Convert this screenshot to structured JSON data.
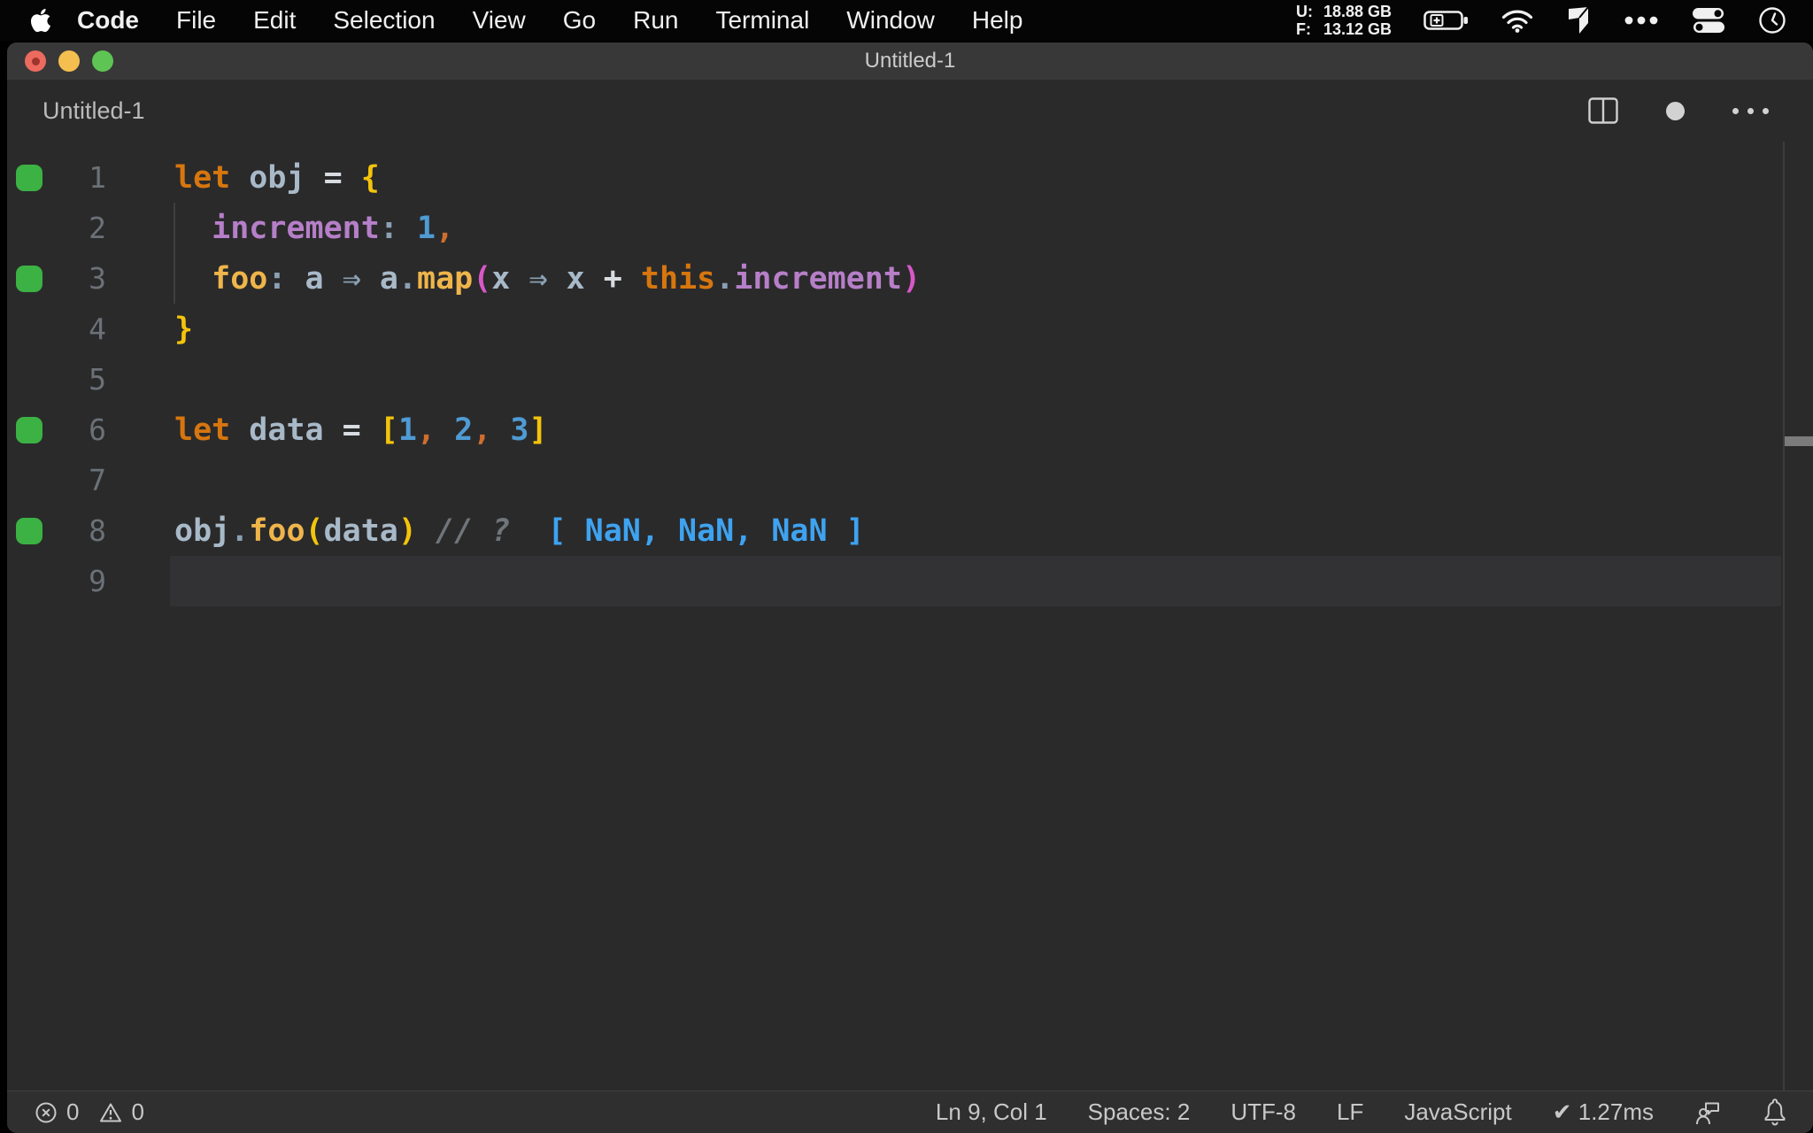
{
  "colors": {
    "kw": "#d7760e",
    "variable": "#a8b9c8",
    "fn": "#efb54a",
    "prop": "#b67fc8",
    "num": "#4f9bd4",
    "comma": "#cf6e2d",
    "br1": "#f3c40b",
    "br2": "#d858c8",
    "op": "#d8dce0",
    "pun": "#8aa0b4",
    "comment": "#70757a",
    "annot": "#3ea3f0",
    "line_num": "#6b7177",
    "coverage_green": "#3bb243",
    "current_line": "#323234",
    "statusbar_bg": "#2f2f30",
    "traffic_red": "#ec6a5e",
    "traffic_red_dot": "#9d352c",
    "traffic_yellow": "#f5bf4f",
    "traffic_green": "#5ec454"
  },
  "menu_bar": {
    "app_name": "Code",
    "items": [
      "File",
      "Edit",
      "Selection",
      "View",
      "Go",
      "Run",
      "Terminal",
      "Window",
      "Help"
    ],
    "memory": {
      "used_label": "U:",
      "used_value": "18.88 GB",
      "free_label": "F:",
      "free_value": "13.12 GB"
    },
    "status_icons": [
      "battery-icon",
      "wifi-icon",
      "app-cube-icon",
      "ellipsis-icon",
      "control-center-icon",
      "clock-icon"
    ]
  },
  "window": {
    "title": "Untitled-1"
  },
  "editor_header": {
    "label": "Untitled-1",
    "icons": [
      "split-editor-icon",
      "unsaved-dot-icon",
      "more-actions-icon"
    ]
  },
  "editor": {
    "language": "javascript",
    "lines": [
      {
        "num": "1",
        "covered": true,
        "tokens": [
          [
            "kw",
            "let"
          ],
          [
            "ws",
            " "
          ],
          [
            "var",
            "obj"
          ],
          [
            "ws",
            " "
          ],
          [
            "op",
            "="
          ],
          [
            "ws",
            " "
          ],
          [
            "br1",
            "{"
          ]
        ]
      },
      {
        "num": "2",
        "indent": true,
        "tokens": [
          [
            "ws",
            "  "
          ],
          [
            "prop",
            "increment"
          ],
          [
            "pun",
            ":"
          ],
          [
            "ws",
            " "
          ],
          [
            "num",
            "1"
          ],
          [
            "comma",
            ","
          ]
        ]
      },
      {
        "num": "3",
        "covered": true,
        "indent": true,
        "tokens": [
          [
            "ws",
            "  "
          ],
          [
            "fn",
            "foo"
          ],
          [
            "pun",
            ":"
          ],
          [
            "ws",
            " "
          ],
          [
            "var",
            "a"
          ],
          [
            "ws",
            " "
          ],
          [
            "arr",
            "⇒"
          ],
          [
            "ws",
            " "
          ],
          [
            "var",
            "a"
          ],
          [
            "dot",
            "."
          ],
          [
            "fn",
            "map"
          ],
          [
            "br2",
            "("
          ],
          [
            "var",
            "x"
          ],
          [
            "ws",
            " "
          ],
          [
            "arr",
            "⇒"
          ],
          [
            "ws",
            " "
          ],
          [
            "var",
            "x"
          ],
          [
            "ws",
            " "
          ],
          [
            "op",
            "+"
          ],
          [
            "ws",
            " "
          ],
          [
            "kw",
            "this"
          ],
          [
            "dot",
            "."
          ],
          [
            "prop",
            "increment"
          ],
          [
            "br2",
            ")"
          ]
        ]
      },
      {
        "num": "4",
        "tokens": [
          [
            "br1",
            "}"
          ]
        ]
      },
      {
        "num": "5",
        "tokens": []
      },
      {
        "num": "6",
        "covered": true,
        "tokens": [
          [
            "kw",
            "let"
          ],
          [
            "ws",
            " "
          ],
          [
            "var",
            "data"
          ],
          [
            "ws",
            " "
          ],
          [
            "op",
            "="
          ],
          [
            "ws",
            " "
          ],
          [
            "br1",
            "["
          ],
          [
            "num",
            "1"
          ],
          [
            "comma",
            ","
          ],
          [
            "ws",
            " "
          ],
          [
            "num",
            "2"
          ],
          [
            "comma",
            ","
          ],
          [
            "ws",
            " "
          ],
          [
            "num",
            "3"
          ],
          [
            "br1",
            "]"
          ]
        ]
      },
      {
        "num": "7",
        "tokens": []
      },
      {
        "num": "8",
        "covered": true,
        "tokens": [
          [
            "var",
            "obj"
          ],
          [
            "dot",
            "."
          ],
          [
            "fn",
            "foo"
          ],
          [
            "br1",
            "("
          ],
          [
            "var",
            "data"
          ],
          [
            "br1",
            ")"
          ],
          [
            "ws",
            " "
          ],
          [
            "cm",
            "// ?"
          ],
          [
            "ws",
            "  "
          ],
          [
            "an",
            "[ NaN, NaN, NaN ]"
          ]
        ]
      },
      {
        "num": "9",
        "current": true,
        "tokens": []
      }
    ]
  },
  "status_bar": {
    "errors_count": "0",
    "warnings_count": "0",
    "right_items": [
      "Ln 9, Col 1",
      "Spaces: 2",
      "UTF-8",
      "LF",
      "JavaScript",
      "✔ 1.27ms"
    ],
    "icons": [
      "error-icon",
      "warning-icon",
      "feedback-icon",
      "bell-icon"
    ]
  }
}
